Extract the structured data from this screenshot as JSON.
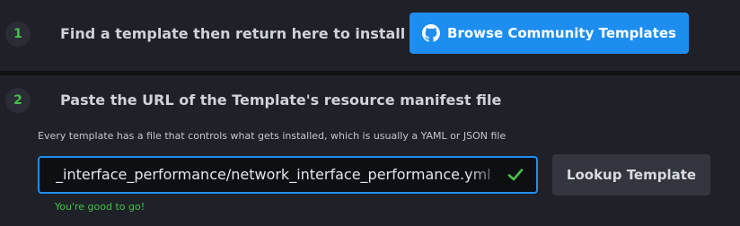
{
  "step1": {
    "number": "1",
    "instruction": "Find a template then return here to install it",
    "browse_button_label": "Browse Community Templates",
    "browse_button_icon": "github-icon"
  },
  "step2": {
    "number": "2",
    "instruction": "Paste the URL of the Template's resource manifest file",
    "hint": "Every template has a file that controls what gets installed, which is usually a YAML or JSON file",
    "url_value": "_interface_performance/network_interface_performance.yml",
    "validation_icon": "check-icon",
    "lookup_button_label": "Lookup Template",
    "status_message": "You're good to go!"
  },
  "colors": {
    "accent": "#1d8ef0",
    "success": "#44c04a",
    "background": "#1f2128"
  }
}
